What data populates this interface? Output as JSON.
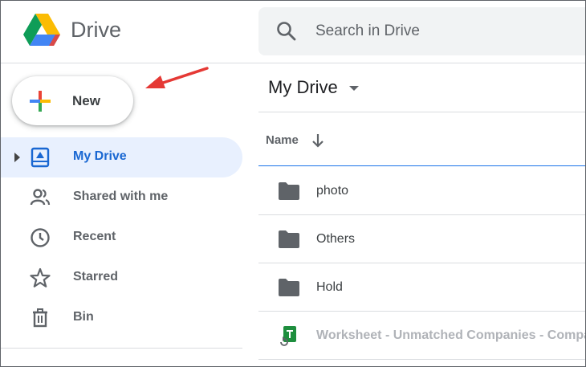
{
  "app": {
    "brand": "Drive",
    "logo_icon": "google-drive-logo",
    "colors": {
      "green": "#0f9d58",
      "blue": "#4285f4",
      "yellow": "#fbbc04",
      "red": "#ea4335",
      "active_bg": "#e8f0fe",
      "active_text": "#1967d2",
      "annotation_arrow": "#e53935"
    }
  },
  "search": {
    "placeholder": "Search in Drive",
    "icon": "search-icon"
  },
  "new_button": {
    "label": "New",
    "icon": "plus-icon"
  },
  "sidebar": {
    "items": [
      {
        "label": "My Drive",
        "icon": "my-drive-icon",
        "active": true,
        "expandable": true
      },
      {
        "label": "Shared with me",
        "icon": "people-icon",
        "active": false
      },
      {
        "label": "Recent",
        "icon": "clock-icon",
        "active": false
      },
      {
        "label": "Starred",
        "icon": "star-icon",
        "active": false
      },
      {
        "label": "Bin",
        "icon": "trash-icon",
        "active": false
      }
    ]
  },
  "main": {
    "title": "My Drive",
    "column_header": "Name",
    "sort": "descending-arrow-icon",
    "files": [
      {
        "name": "photo",
        "type": "folder",
        "icon": "folder-icon"
      },
      {
        "name": "Others",
        "type": "folder",
        "icon": "folder-icon"
      },
      {
        "name": "Hold",
        "type": "folder",
        "icon": "folder-icon"
      },
      {
        "name": "Worksheet - Unmatched Companies - Compan",
        "type": "sheet-converting",
        "icon": "sheets-convert-icon"
      }
    ]
  }
}
